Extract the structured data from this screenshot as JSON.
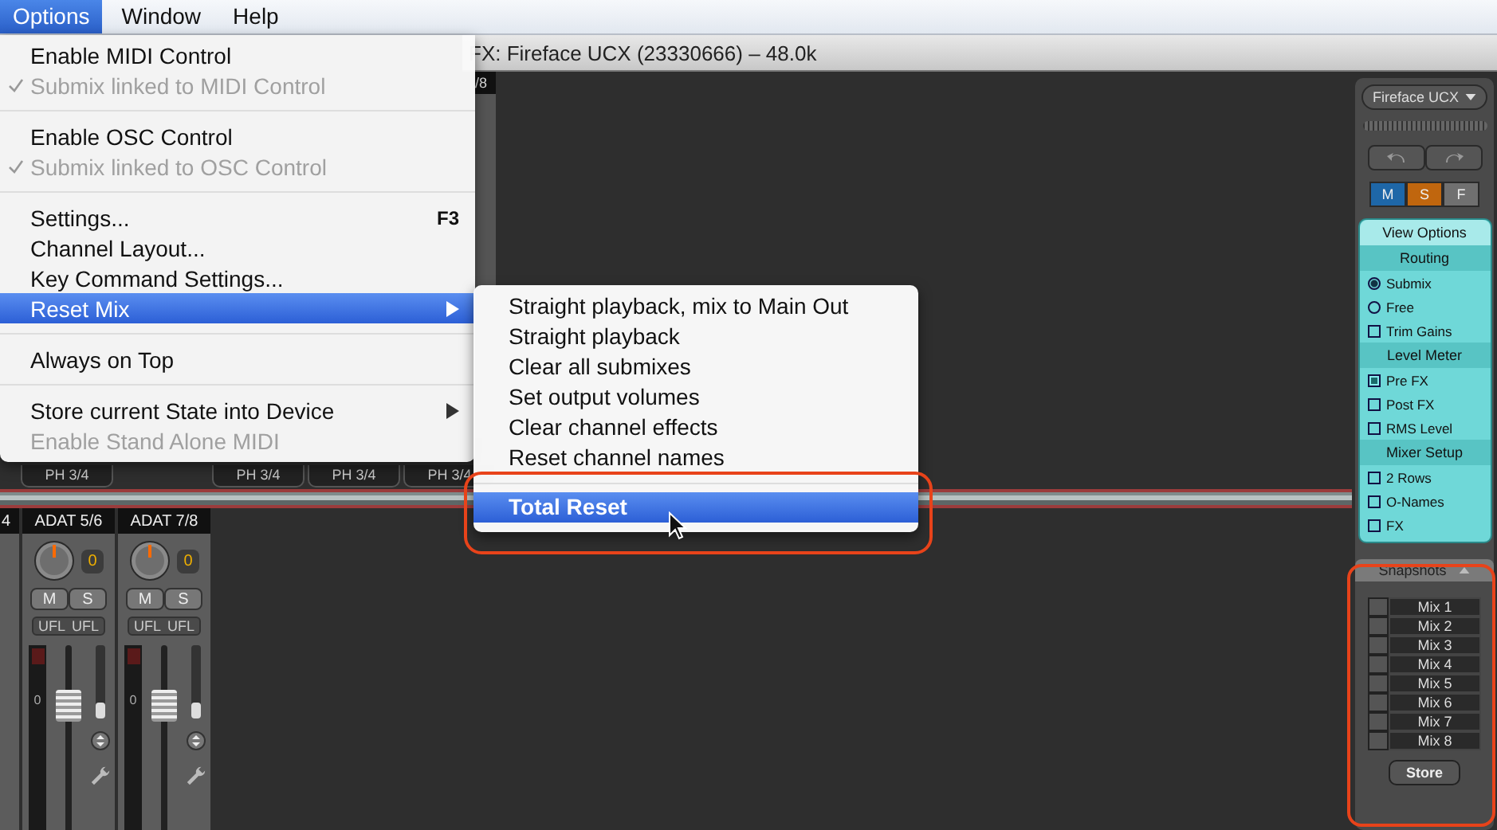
{
  "menubar": [
    {
      "label": "Options",
      "selected": true
    },
    {
      "label": "Window",
      "selected": false
    },
    {
      "label": "Help",
      "selected": false
    }
  ],
  "window": {
    "title": "FX: Fireface UCX (23330666) – 48.0k"
  },
  "options_menu": {
    "groups": [
      [
        {
          "label": "Enable MIDI Control",
          "checked": false,
          "disabled": false,
          "selected": false,
          "has_submenu": false
        },
        {
          "label": "Submix linked to MIDI Control",
          "checked": true,
          "disabled": true,
          "selected": false,
          "has_submenu": false
        }
      ],
      [
        {
          "label": "Enable OSC Control",
          "checked": false,
          "disabled": false,
          "selected": false,
          "has_submenu": false
        },
        {
          "label": "Submix linked to OSC Control",
          "checked": true,
          "disabled": true,
          "selected": false,
          "has_submenu": false
        }
      ],
      [
        {
          "label": "Settings...",
          "shortcut": "F3",
          "checked": false,
          "disabled": false,
          "selected": false,
          "has_submenu": false
        },
        {
          "label": "Channel Layout...",
          "checked": false,
          "disabled": false,
          "selected": false,
          "has_submenu": false
        },
        {
          "label": "Key Command Settings...",
          "checked": false,
          "disabled": false,
          "selected": false,
          "has_submenu": false
        },
        {
          "label": "Reset Mix",
          "checked": false,
          "disabled": false,
          "selected": true,
          "has_submenu": true
        }
      ],
      [
        {
          "label": "Always on Top",
          "checked": false,
          "disabled": false,
          "selected": false,
          "has_submenu": false
        }
      ],
      [
        {
          "label": "Store current State into Device",
          "checked": false,
          "disabled": false,
          "selected": false,
          "has_submenu": true
        },
        {
          "label": "Enable Stand Alone MIDI",
          "checked": false,
          "disabled": true,
          "selected": false,
          "has_submenu": false
        }
      ]
    ]
  },
  "reset_mix_submenu": {
    "groups": [
      [
        {
          "label": "Straight playback, mix to Main Out",
          "selected": false
        },
        {
          "label": "Straight playback",
          "selected": false
        },
        {
          "label": "Clear all submixes",
          "selected": false
        },
        {
          "label": "Set output volumes",
          "selected": false
        },
        {
          "label": "Clear channel effects",
          "selected": false
        },
        {
          "label": "Reset channel names",
          "selected": false
        }
      ],
      [
        {
          "label": "Total Reset",
          "selected": true
        }
      ]
    ]
  },
  "mixer": {
    "top_row": {
      "strip_label": "/8",
      "tabs": [
        "PH 3/4",
        "PH 3/4",
        "PH 3/4",
        "PH 3/4"
      ]
    },
    "channels": [
      {
        "kind": "partial",
        "name": "4"
      },
      {
        "kind": "full",
        "name": "ADAT 5/6",
        "gain": "0",
        "mute": "M",
        "solo": "S",
        "flags": [
          "UFL",
          "UFL"
        ],
        "meter_mark": "0",
        "level": 0.75,
        "trim": {
          "level": 0.22
        }
      },
      {
        "kind": "full",
        "name": "ADAT 7/8",
        "gain": "0",
        "mute": "M",
        "solo": "S",
        "flags": [
          "UFL",
          "UFL"
        ],
        "meter_mark": "0",
        "level": 0.75,
        "trim": {
          "level": 0.22
        }
      }
    ]
  },
  "side_panel": {
    "device": "Fireface UCX",
    "mode_buttons": [
      {
        "label": "M",
        "color": "#1e67a8"
      },
      {
        "label": "S",
        "color": "#c0660e"
      },
      {
        "label": "F",
        "color": "#707070"
      }
    ],
    "view_options": {
      "title": "View Options",
      "sections": [
        {
          "title": "Routing",
          "options": [
            {
              "label": "Submix",
              "kind": "radio",
              "checked": true
            },
            {
              "label": "Free",
              "kind": "radio",
              "checked": false
            },
            {
              "label": "Trim Gains",
              "kind": "checkbox",
              "checked": false
            }
          ]
        },
        {
          "title": "Level Meter",
          "options": [
            {
              "label": "Pre FX",
              "kind": "checkbox",
              "checked": true
            },
            {
              "label": "Post FX",
              "kind": "checkbox",
              "checked": false
            },
            {
              "label": "RMS Level",
              "kind": "checkbox",
              "checked": false
            }
          ]
        },
        {
          "title": "Mixer Setup",
          "options": [
            {
              "label": "2 Rows",
              "kind": "checkbox",
              "checked": false
            },
            {
              "label": "O-Names",
              "kind": "checkbox",
              "checked": false
            },
            {
              "label": "FX",
              "kind": "checkbox",
              "checked": false
            }
          ]
        }
      ]
    },
    "snapshots": {
      "title": "Snapshots",
      "items": [
        "Mix  1",
        "Mix  2",
        "Mix  3",
        "Mix  4",
        "Mix  5",
        "Mix  6",
        "Mix  7",
        "Mix  8"
      ],
      "store": "Store"
    }
  }
}
